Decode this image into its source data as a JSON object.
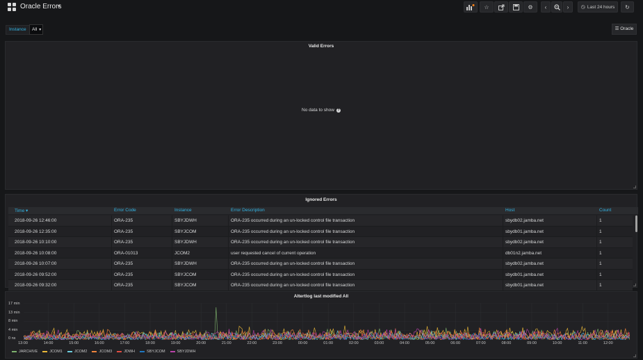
{
  "dashboard": {
    "title": "Oracle Errors"
  },
  "toolbar": {
    "time_range": "Last 24 hours"
  },
  "variables": {
    "instance_label": "Instance",
    "instance_value": "All"
  },
  "links": {
    "oracle": "Oracle"
  },
  "panels": {
    "valid": {
      "title": "Valid Errors",
      "no_data": "No data to show"
    },
    "ignored": {
      "title": "Ignored Errors",
      "columns": [
        "Time",
        "Error Code",
        "Instance",
        "Error Description",
        "Host",
        "Count"
      ],
      "rows": [
        [
          "2018-09-26 12:46:00",
          "ORA-235",
          "SBYJDWH",
          "ORA-235 occurred during an un-locked control file transaction",
          "sbydb02.jamba.net",
          "1"
        ],
        [
          "2018-09-26 12:35:00",
          "ORA-235",
          "SBYJCOM",
          "ORA-235 occurred during an un-locked control file transaction",
          "sbydb01.jamba.net",
          "1"
        ],
        [
          "2018-09-26 10:10:00",
          "ORA-235",
          "SBYJDWH",
          "ORA-235 occurred during an un-locked control file transaction",
          "sbydb02.jamba.net",
          "1"
        ],
        [
          "2018-09-26 10:08:00",
          "ORA-01013",
          "JCOM2",
          "user requested cancel of current operation",
          "db01n2.jamba.net",
          "1"
        ],
        [
          "2018-09-26 10:07:00",
          "ORA-235",
          "SBYJDWH",
          "ORA-235 occurred during an un-locked control file transaction",
          "sbydb02.jamba.net",
          "1"
        ],
        [
          "2018-09-26 09:52:00",
          "ORA-235",
          "SBYJCOM",
          "ORA-235 occurred during an un-locked control file transaction",
          "sbydb01.jamba.net",
          "1"
        ],
        [
          "2018-09-26 09:32:00",
          "ORA-235",
          "SBYJCOM",
          "ORA-235 occurred during an un-locked control file transaction",
          "sbydb01.jamba.net",
          "1"
        ]
      ]
    },
    "alertlog": {
      "title": "Altertlog last modified All"
    }
  },
  "chart_data": {
    "type": "line",
    "title": "Altertlog last modified All",
    "y_ticks": [
      "17 min",
      "13 min",
      "8 min",
      "4 min",
      "0 ns"
    ],
    "x_ticks": [
      "13:00",
      "14:00",
      "15:00",
      "16:00",
      "17:00",
      "18:00",
      "19:00",
      "20:00",
      "21:00",
      "22:00",
      "23:00",
      "00:00",
      "01:00",
      "02:00",
      "03:00",
      "04:00",
      "05:00",
      "06:00",
      "07:00",
      "08:00",
      "09:00",
      "10:00",
      "11:00",
      "12:00"
    ],
    "ylim_minutes": [
      0,
      17
    ],
    "grid": true,
    "legend_placement": "bottom-left",
    "series": [
      {
        "name": "JARCHIVE",
        "color": "#7eb26d",
        "typical_peak_min": 5,
        "spike": {
          "at": "20:30",
          "value_min": 15
        }
      },
      {
        "name": "JCOM1",
        "color": "#eab839",
        "typical_peak_min": 6
      },
      {
        "name": "JCOM2",
        "color": "#6ed0e0",
        "typical_peak_min": 4
      },
      {
        "name": "JCOM3",
        "color": "#ef843c",
        "typical_peak_min": 5
      },
      {
        "name": "JDWH",
        "color": "#e24d42",
        "typical_peak_min": 4
      },
      {
        "name": "SBYJCOM",
        "color": "#1f78c1",
        "typical_peak_min": 3
      },
      {
        "name": "SBYJDWH",
        "color": "#ba43a9",
        "typical_peak_min": 5
      }
    ]
  }
}
